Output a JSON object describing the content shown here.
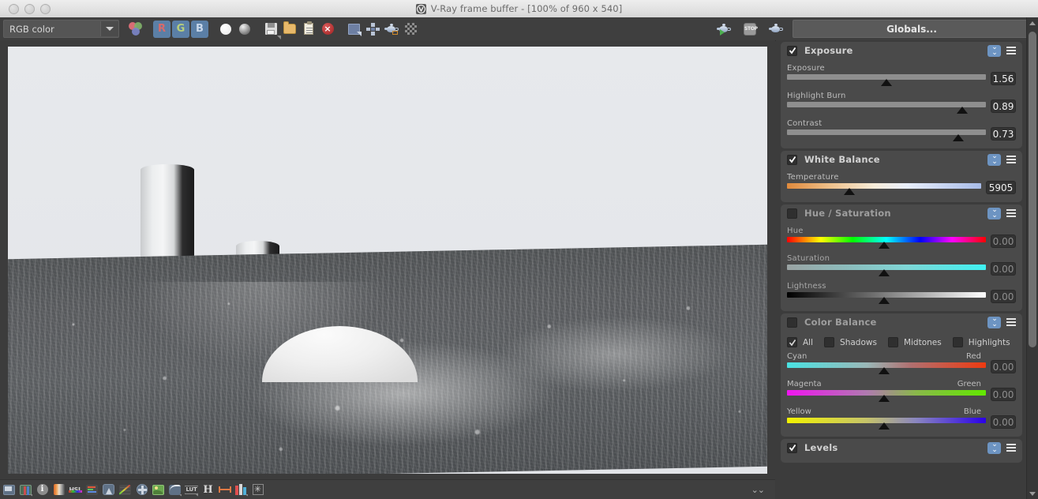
{
  "window": {
    "title": "V-Ray frame buffer - [100% of 960 x 540]",
    "logo_icon": "vray-logo-icon",
    "traffic_lights": [
      "close",
      "minimize",
      "maximize"
    ]
  },
  "toolbar": {
    "channel_select": {
      "value": "RGB color",
      "icon": "chevron-down-icon"
    },
    "buttons": [
      {
        "name": "color-channels-icon",
        "label": "",
        "icon": "rgb-balls-icon",
        "active": false
      },
      {
        "name": "red-channel-button",
        "label": "R",
        "icon": "channel-r-icon",
        "active": true
      },
      {
        "name": "green-channel-button",
        "label": "G",
        "icon": "channel-g-icon",
        "active": true
      },
      {
        "name": "blue-channel-button",
        "label": "B",
        "icon": "channel-b-icon",
        "active": true
      },
      {
        "name": "alpha-channel-button",
        "label": "",
        "icon": "white-sphere-icon",
        "active": false
      },
      {
        "name": "monochrome-button",
        "label": "",
        "icon": "gray-sphere-icon",
        "active": false
      },
      {
        "name": "save-image-button",
        "label": "",
        "icon": "floppy-save-icon",
        "active": false
      },
      {
        "name": "load-image-button",
        "label": "",
        "icon": "folder-open-icon",
        "active": false
      },
      {
        "name": "copy-to-clipboard-button",
        "label": "",
        "icon": "clipboard-icon",
        "active": false
      },
      {
        "name": "clear-image-button",
        "label": "",
        "icon": "red-x-circle-icon",
        "active": false
      },
      {
        "name": "resize-window-button",
        "label": "",
        "icon": "resize-arrow-icon",
        "active": false
      },
      {
        "name": "pan-button",
        "label": "",
        "icon": "move-cross-icon",
        "active": false
      },
      {
        "name": "render-region-button",
        "label": "",
        "icon": "teapot-region-icon",
        "active": false
      },
      {
        "name": "alpha-checker-button",
        "label": "",
        "icon": "checkerboard-icon",
        "active": false
      }
    ],
    "right_buttons": [
      {
        "name": "render-last-button",
        "icon": "teapot-play-icon"
      },
      {
        "name": "stop-render-button",
        "icon": "stop-sign-icon"
      },
      {
        "name": "render-button",
        "icon": "teapot-icon"
      }
    ],
    "globals_label": "Globals..."
  },
  "bottom_toolbar": {
    "buttons": [
      {
        "name": "frame-buffer-button",
        "icon": "frame-icon"
      },
      {
        "name": "stereo-button",
        "icon": "stereo-icon"
      },
      {
        "name": "info-button",
        "icon": "info-icon"
      },
      {
        "name": "color-corrections-button",
        "icon": "gradient-icon"
      },
      {
        "name": "hsl-button",
        "icon": "hsl-icon"
      },
      {
        "name": "color-balance-button",
        "icon": "color-bars-icon"
      },
      {
        "name": "lens-effects-button",
        "icon": "lens-icon"
      },
      {
        "name": "curve-button",
        "icon": "curve-icon"
      },
      {
        "name": "vignette-button",
        "icon": "fan-icon"
      },
      {
        "name": "background-button",
        "icon": "photo-icon"
      },
      {
        "name": "exposure-curve-button",
        "icon": "exposure-curve-icon"
      },
      {
        "name": "lut-button",
        "icon": "lut-icon"
      },
      {
        "name": "hue-button",
        "icon": "letter-h-icon"
      },
      {
        "name": "levels-range-button",
        "icon": "double-arrow-icon"
      },
      {
        "name": "rgb-histogram-button",
        "icon": "rgb-bars-icon"
      },
      {
        "name": "denoise-button",
        "icon": "snowflake-icon"
      }
    ],
    "collapse_icon": "double-chevron-down-icon"
  },
  "panel": {
    "sections": [
      {
        "name": "exposure",
        "title": "Exposure",
        "enabled": true,
        "expand_icon": "double-chevron-down-icon",
        "menu_icon": "hamburger-menu-icon",
        "sliders": [
          {
            "name": "exposure-slider",
            "label": "Exposure",
            "value": "1.56",
            "pos": 50,
            "gradient": "plain"
          },
          {
            "name": "highlight-burn-slider",
            "label": "Highlight Burn",
            "value": "0.89",
            "pos": 88,
            "gradient": "plain"
          },
          {
            "name": "contrast-slider",
            "label": "Contrast",
            "value": "0.73",
            "pos": 86,
            "gradient": "plain"
          }
        ]
      },
      {
        "name": "white-balance",
        "title": "White Balance",
        "enabled": true,
        "expand_icon": "double-chevron-down-icon",
        "menu_icon": "hamburger-menu-icon",
        "sliders": [
          {
            "name": "temperature-slider",
            "label": "Temperature",
            "value": "5905",
            "pos": 32,
            "gradient": "temperature"
          }
        ]
      },
      {
        "name": "hue-saturation",
        "title": "Hue / Saturation",
        "enabled": false,
        "expand_icon": "double-chevron-down-icon",
        "menu_icon": "hamburger-menu-icon",
        "sliders": [
          {
            "name": "hue-slider",
            "label": "Hue",
            "value": "0.00",
            "pos": 49,
            "gradient": "hue"
          },
          {
            "name": "saturation-slider",
            "label": "Saturation",
            "value": "0.00",
            "pos": 49,
            "gradient": "saturation"
          },
          {
            "name": "lightness-slider",
            "label": "Lightness",
            "value": "0.00",
            "pos": 49,
            "gradient": "lightness"
          }
        ]
      },
      {
        "name": "color-balance",
        "title": "Color Balance",
        "enabled": false,
        "expand_icon": "double-chevron-down-icon",
        "menu_icon": "hamburger-menu-icon",
        "modes": [
          {
            "name": "mode-all",
            "label": "All",
            "checked": true
          },
          {
            "name": "mode-shadows",
            "label": "Shadows",
            "checked": false
          },
          {
            "name": "mode-midtones",
            "label": "Midtones",
            "checked": false
          },
          {
            "name": "mode-highlights",
            "label": "Highlights",
            "checked": false
          }
        ],
        "sliders": [
          {
            "name": "cyan-red-slider",
            "label": "Cyan",
            "label_right": "Red",
            "value": "0.00",
            "pos": 49,
            "gradient": "cyan-red"
          },
          {
            "name": "magenta-green-slider",
            "label": "Magenta",
            "label_right": "Green",
            "value": "0.00",
            "pos": 49,
            "gradient": "magenta-green"
          },
          {
            "name": "yellow-blue-slider",
            "label": "Yellow",
            "label_right": "Blue",
            "value": "0.00",
            "pos": 49,
            "gradient": "yellow-blue"
          }
        ]
      },
      {
        "name": "levels",
        "title": "Levels",
        "enabled": true,
        "expand_icon": "double-chevron-down-icon",
        "menu_icon": "hamburger-menu-icon",
        "sliders": []
      }
    ]
  },
  "scrollbar": {
    "up_icon": "scroll-up-arrow-icon",
    "down_icon": "scroll-down-arrow-icon"
  },
  "colors": {
    "accent": "#6d94c2",
    "panel_bg": "#4a4a4a",
    "app_bg": "#3c3c3c",
    "toolbar_bg": "#3f3f3f",
    "active_toggle": "#5b7fa6"
  }
}
